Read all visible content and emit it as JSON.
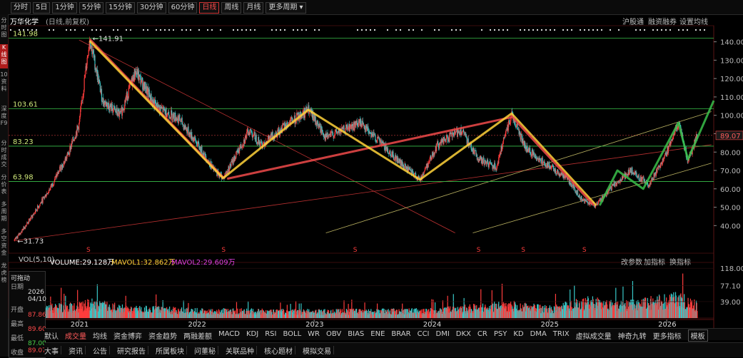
{
  "toolbar": {
    "timeframes": [
      "分时",
      "5日",
      "1分钟",
      "5分钟",
      "15分钟",
      "30分钟",
      "60分钟",
      "日线",
      "周线",
      "月线",
      "更多周期"
    ],
    "active_index": 7
  },
  "side_tabs": [
    "分时图",
    "K线图",
    "10资料",
    "深度F9",
    "分时成交",
    "分价表",
    "多周期",
    "多空资金",
    "龙虎榜"
  ],
  "side_active_index": 1,
  "title": {
    "stock": "万华化学",
    "mode": "(日线,前复权)",
    "right_items": [
      "沪股通",
      "融资融券",
      "设置均线"
    ]
  },
  "volume_header": {
    "label": "VOL(5,10)",
    "volume": "VOLUME:29.128万",
    "mavol1": "MAVOL1:32.862万",
    "mavol2": "MAVOL2:29.609万",
    "right_items": [
      "改参数",
      "加指标",
      "换指标"
    ]
  },
  "infobox": {
    "header": "可拖动",
    "date_label": "日期",
    "year": "2026",
    "date": "04/10",
    "open_label": "开盘",
    "open": "87.86",
    "high_label": "最高",
    "high": "89.60",
    "low_label": "最低",
    "low": "87.00",
    "close_label": "收盘",
    "close": "89.07"
  },
  "indicators": {
    "items": [
      "默认",
      "成交量",
      "均线",
      "资金博弈",
      "资金趋势",
      "两融差额",
      "MACD",
      "KDJ",
      "RSI",
      "BOLL",
      "WR",
      "OBV",
      "BIAS",
      "ENE",
      "BRAR",
      "CCI",
      "DMI",
      "DKX",
      "CR",
      "PSY",
      "KD",
      "DMA",
      "TRIX",
      "虚拟成交量",
      "神奇九转",
      "更多指标",
      "模板"
    ],
    "active_index": 1
  },
  "bottom_tabs": [
    "大事",
    "资讯",
    "公告",
    "研究报告",
    "所属板块",
    "问董秘",
    "关联品种",
    "核心题材",
    "模拟交易"
  ],
  "chart_data": {
    "type": "candlestick",
    "xlabels": [
      "2021",
      "2022",
      "2023",
      "2024",
      "2025",
      "2026"
    ],
    "ylim": [
      25,
      148
    ],
    "yticks": [
      40,
      50,
      60,
      70,
      80,
      90,
      100,
      110,
      120,
      130,
      140
    ],
    "price_levels": [
      {
        "value": 141.98,
        "label": "141.98"
      },
      {
        "value": 103.61,
        "label": "103.61"
      },
      {
        "value": 83.23,
        "label": "83.23"
      },
      {
        "value": 63.98,
        "label": "63.98"
      }
    ],
    "last_price": "89.07",
    "annotations": {
      "high": "141.91",
      "low": "31.73"
    },
    "price_path": [
      {
        "t": 2020.45,
        "v": 31.7
      },
      {
        "t": 2020.6,
        "v": 45
      },
      {
        "t": 2020.75,
        "v": 60
      },
      {
        "t": 2020.9,
        "v": 78
      },
      {
        "t": 2021.0,
        "v": 95
      },
      {
        "t": 2021.09,
        "v": 141.9
      },
      {
        "t": 2021.2,
        "v": 108
      },
      {
        "t": 2021.35,
        "v": 100
      },
      {
        "t": 2021.48,
        "v": 124
      },
      {
        "t": 2021.65,
        "v": 105
      },
      {
        "t": 2021.85,
        "v": 98
      },
      {
        "t": 2022.0,
        "v": 85
      },
      {
        "t": 2022.15,
        "v": 70
      },
      {
        "t": 2022.23,
        "v": 66
      },
      {
        "t": 2022.35,
        "v": 80
      },
      {
        "t": 2022.45,
        "v": 92
      },
      {
        "t": 2022.55,
        "v": 84
      },
      {
        "t": 2022.75,
        "v": 94
      },
      {
        "t": 2022.95,
        "v": 103
      },
      {
        "t": 2023.1,
        "v": 88
      },
      {
        "t": 2023.25,
        "v": 92
      },
      {
        "t": 2023.4,
        "v": 96
      },
      {
        "t": 2023.55,
        "v": 86
      },
      {
        "t": 2023.75,
        "v": 73
      },
      {
        "t": 2023.9,
        "v": 65
      },
      {
        "t": 2024.05,
        "v": 84
      },
      {
        "t": 2024.25,
        "v": 92
      },
      {
        "t": 2024.4,
        "v": 76
      },
      {
        "t": 2024.55,
        "v": 72
      },
      {
        "t": 2024.68,
        "v": 101
      },
      {
        "t": 2024.8,
        "v": 82
      },
      {
        "t": 2025.0,
        "v": 72
      },
      {
        "t": 2025.15,
        "v": 66
      },
      {
        "t": 2025.28,
        "v": 54
      },
      {
        "t": 2025.4,
        "v": 51
      },
      {
        "t": 2025.55,
        "v": 62
      },
      {
        "t": 2025.7,
        "v": 70
      },
      {
        "t": 2025.85,
        "v": 62
      },
      {
        "t": 2026.0,
        "v": 80
      },
      {
        "t": 2026.1,
        "v": 96
      },
      {
        "t": 2026.18,
        "v": 75
      },
      {
        "t": 2026.26,
        "v": 89
      }
    ],
    "trend_lines": [
      {
        "color": "#f04a4a",
        "points": [
          {
            "t": 2021.09,
            "v": 141.5
          },
          {
            "t": 2022.23,
            "v": 66
          }
        ]
      },
      {
        "color": "#ffd23a",
        "points": [
          {
            "t": 2021.09,
            "v": 140.5
          },
          {
            "t": 2022.23,
            "v": 65.5
          }
        ]
      },
      {
        "color": "#f04a4a",
        "points": [
          {
            "t": 2022.26,
            "v": 65.5
          },
          {
            "t": 2024.68,
            "v": 99
          }
        ]
      },
      {
        "color": "#ffd23a",
        "points": [
          {
            "t": 2022.23,
            "v": 66
          },
          {
            "t": 2022.95,
            "v": 103
          },
          {
            "t": 2023.9,
            "v": 65
          },
          {
            "t": 2024.68,
            "v": 101
          },
          {
            "t": 2025.4,
            "v": 51
          }
        ]
      },
      {
        "color": "#f04a4a",
        "points": [
          {
            "t": 2024.68,
            "v": 99.5
          },
          {
            "t": 2025.38,
            "v": 51
          }
        ]
      },
      {
        "color": "#39c04a",
        "points": [
          {
            "t": 2025.43,
            "v": 51
          },
          {
            "t": 2025.58,
            "v": 70
          },
          {
            "t": 2025.8,
            "v": 60
          },
          {
            "t": 2026.1,
            "v": 96
          },
          {
            "t": 2026.18,
            "v": 76
          },
          {
            "t": 2026.4,
            "v": 108
          }
        ]
      }
    ],
    "thin_lines": [
      {
        "color": "#b83030",
        "points": [
          {
            "t": 2020.45,
            "v": 31.7
          },
          {
            "t": 2026.38,
            "v": 84
          }
        ]
      },
      {
        "color": "#b83030",
        "points": [
          {
            "t": 2021.0,
            "v": 141
          },
          {
            "t": 2024.2,
            "v": 36
          }
        ]
      },
      {
        "color": "#b8b060",
        "points": [
          {
            "t": 2023.1,
            "v": 36
          },
          {
            "t": 2026.38,
            "v": 102
          }
        ]
      },
      {
        "color": "#b8b060",
        "points": [
          {
            "t": 2024.35,
            "v": 36
          },
          {
            "t": 2026.38,
            "v": 74
          }
        ]
      }
    ],
    "volume": {
      "ylim": [
        0,
        125
      ],
      "yticks": [
        {
          "value": 118,
          "label": "118.00"
        },
        {
          "value": 77.1,
          "label": "77.10"
        },
        {
          "value": 39,
          "label": "39.00"
        }
      ],
      "profile": [
        {
          "t": 2020.45,
          "v": 22
        },
        {
          "t": 2021.0,
          "v": 28
        },
        {
          "t": 2021.09,
          "v": 35
        },
        {
          "t": 2021.4,
          "v": 24
        },
        {
          "t": 2022.0,
          "v": 18
        },
        {
          "t": 2023.0,
          "v": 16
        },
        {
          "t": 2024.0,
          "v": 18
        },
        {
          "t": 2024.65,
          "v": 32
        },
        {
          "t": 2025.0,
          "v": 22
        },
        {
          "t": 2025.35,
          "v": 40
        },
        {
          "t": 2025.6,
          "v": 30
        },
        {
          "t": 2026.1,
          "v": 48
        },
        {
          "t": 2026.26,
          "v": 30
        }
      ]
    }
  }
}
